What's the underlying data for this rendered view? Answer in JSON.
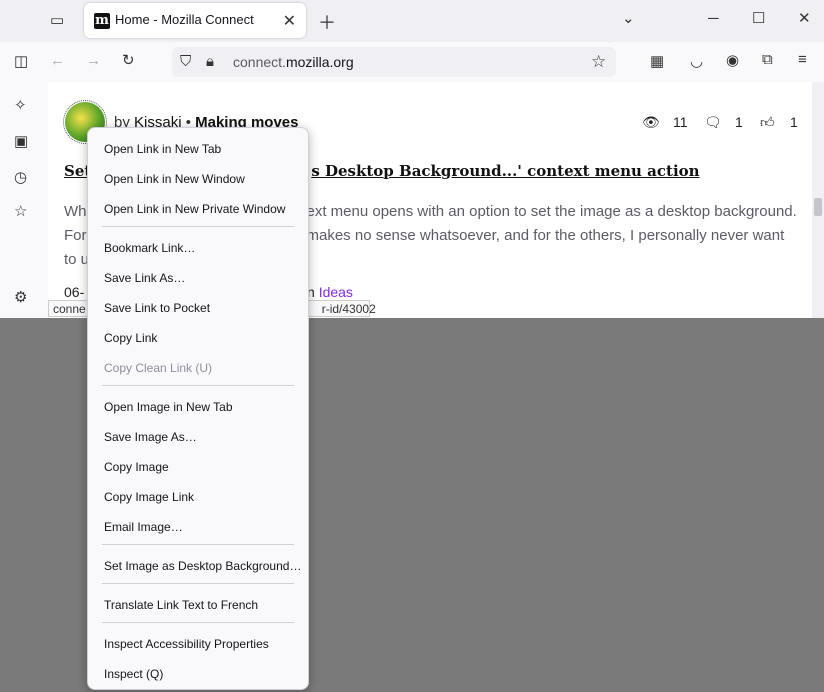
{
  "browser": {
    "tab_title": "Home - Mozilla Connect",
    "tab_favicon": "m",
    "url_prefix": "connect.",
    "url_domain": "mozilla.org"
  },
  "post": {
    "author_prefix": "by",
    "author": "Kissaki",
    "rank": "Making moves",
    "views": "11",
    "comments": "1",
    "likes": "1",
    "title_start": "Set",
    "title_end": "s Desktop Background...' context menu action",
    "body_line1_start": "Wh",
    "body_line1_end": "ext menu opens with an option to set the image as a desktop background.",
    "body_line2_start": "For",
    "body_line2_end": "makes no sense whatsoever, and for the others, I personally never want",
    "body_line3_start": "to u",
    "date_start": "06-",
    "ideas_prefix": "n",
    "ideas_label": "Ideas"
  },
  "status_bar": {
    "url_start": "conne",
    "url_end": "r-id/43002"
  },
  "context_menu": {
    "open_new_tab": "Open Link in New Tab",
    "open_new_window": "Open Link in New Window",
    "open_private_window": "Open Link in New Private Window",
    "bookmark_link": "Bookmark Link…",
    "save_link_as": "Save Link As…",
    "save_to_pocket": "Save Link to Pocket",
    "copy_link": "Copy Link",
    "copy_clean_link": "Copy Clean Link (U)",
    "open_image_new_tab": "Open Image in New Tab",
    "save_image_as": "Save Image As…",
    "copy_image": "Copy Image",
    "copy_image_link": "Copy Image Link",
    "email_image": "Email Image…",
    "set_desktop_background": "Set Image as Desktop Background…",
    "translate_link": "Translate Link Text to French",
    "inspect_accessibility": "Inspect Accessibility Properties",
    "inspect": "Inspect (Q)"
  },
  "colors": {
    "accent": "#0060df",
    "ideas_link": "#8a2be2",
    "menu_bg": "#f9f9fb",
    "page_backdrop": "#7a7a7a"
  }
}
